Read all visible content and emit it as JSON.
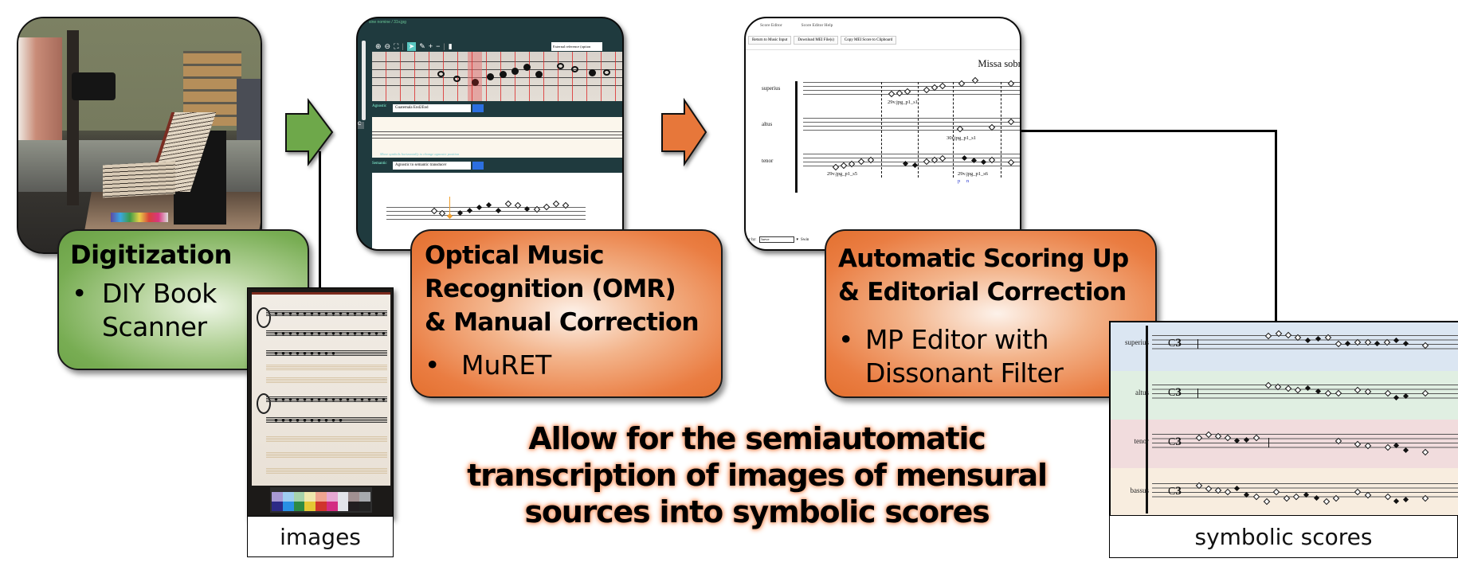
{
  "steps": {
    "digitization": {
      "title": "Digitization",
      "bullets": [
        "DIY Book Scanner"
      ],
      "color": "#6ea84a",
      "photo_alt": "book-scanner-photo"
    },
    "omr": {
      "title_lines": [
        "Optical Music",
        "Recognition (OMR)",
        "& Manual Correction"
      ],
      "bullets": [
        "MuRET"
      ],
      "color": "#e7773a"
    },
    "scoring": {
      "title_lines": [
        "Automatic Scoring Up",
        "& Editorial Correction"
      ],
      "bullets": [
        "MP Editor with Dissonant Filter"
      ],
      "bullet_lines": [
        "MP Editor with",
        "Dissonant Filter"
      ],
      "color": "#e7773a"
    }
  },
  "arrows": [
    {
      "name": "digitization-to-omr",
      "color": "#6ea84a"
    },
    {
      "name": "omr-to-scoring",
      "color": "#e7773a"
    }
  ],
  "bullet_glyph": "•",
  "images_label": "images",
  "symbolic_label": "symbolic scores",
  "tagline_lines": [
    "Allow for the semiautomatic",
    "transcription of images of mensural",
    "sources into symbolic scores"
  ],
  "muret_screen": {
    "breadcrumb": "sine nomine / 31v.jpg",
    "toolbar_icons": [
      "zoom-in",
      "zoom-out",
      "fit",
      "select",
      "edit",
      "add",
      "remove",
      "delete"
    ],
    "tooltip": "External reference (option",
    "agnostic_label": "Agnostic",
    "agnostic_value": "Guatemala End2End",
    "agnostic_hint": "Move symbols horizontally to change agnostic position",
    "semantic_label": "Semantic",
    "semantic_value": "Agnostic to semantic transducer",
    "side_button": "C"
  },
  "score_editor_screen": {
    "menu": [
      "Score Editor",
      "Score Editor Help"
    ],
    "buttons": [
      "Return to Music Input",
      "Download MEI File(s)",
      "Copy MEI Score to Clipboard"
    ],
    "piece_title": "Missa sobre l",
    "voices": [
      "superius",
      "altus",
      "tenor"
    ],
    "source_labels": [
      "29v.jpg_p1_s1",
      "30r.jpg_p1_s1",
      "29v.jpg_p1_s5",
      "29v.jpg_p1_s6"
    ],
    "marks": [
      "p",
      "n"
    ],
    "sort_label": "er by:",
    "sort_value": "breve",
    "swing_label": "Swin"
  },
  "symbolic_score": {
    "voices": [
      {
        "name": "superius",
        "band_color": "#dbe6f2"
      },
      {
        "name": "altus",
        "band_color": "#e0efe2"
      },
      {
        "name": "tenor",
        "band_color": "#f1dcdd"
      },
      {
        "name": "bassus",
        "band_color": "#f8eddf"
      }
    ],
    "mensuration": "C",
    "proportion": "3"
  }
}
